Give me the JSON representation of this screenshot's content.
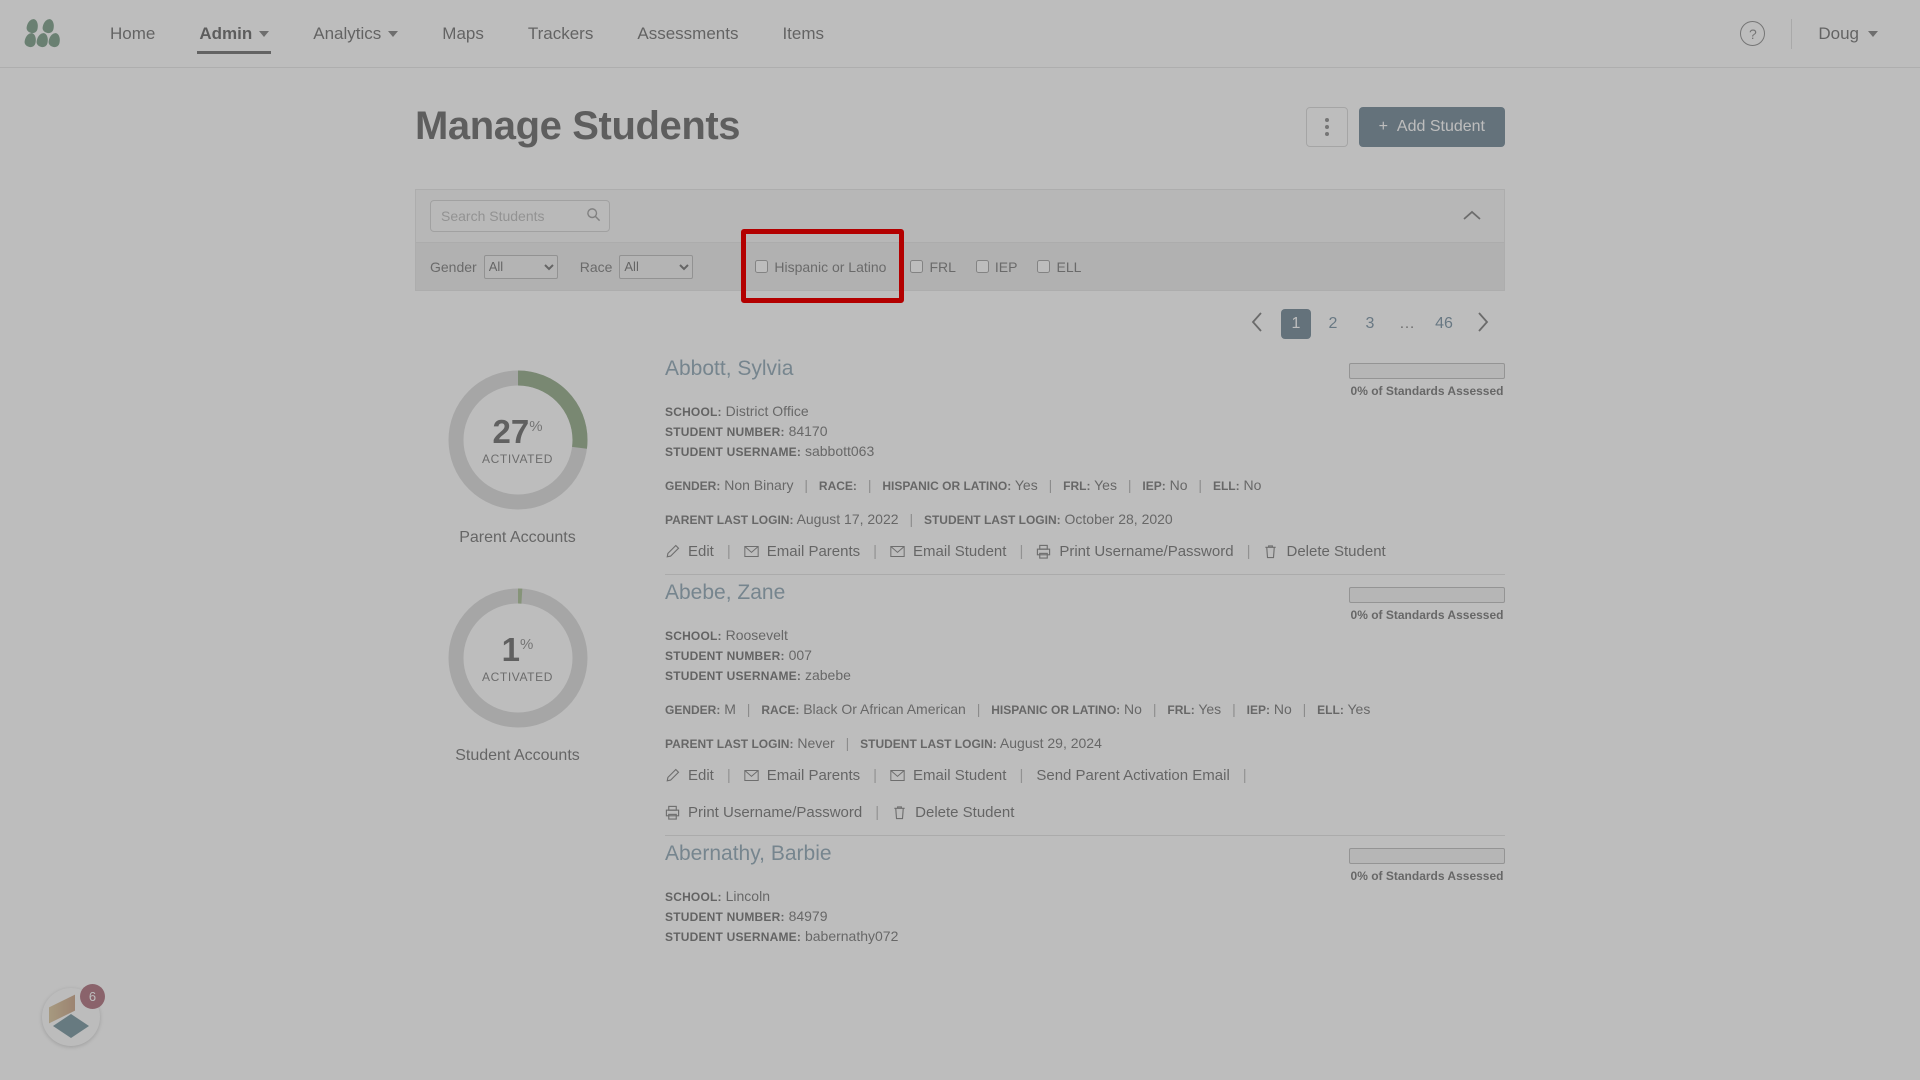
{
  "nav": {
    "logo_name": "masterybook-logo",
    "items": [
      {
        "label": "Home",
        "has_caret": false,
        "active": false
      },
      {
        "label": "Admin",
        "has_caret": true,
        "active": true
      },
      {
        "label": "Analytics",
        "has_caret": true,
        "active": false
      },
      {
        "label": "Maps",
        "has_caret": false,
        "active": false
      },
      {
        "label": "Trackers",
        "has_caret": false,
        "active": false
      },
      {
        "label": "Assessments",
        "has_caret": false,
        "active": false
      },
      {
        "label": "Items",
        "has_caret": false,
        "active": false
      }
    ],
    "help_glyph": "?",
    "user": "Doug"
  },
  "header": {
    "title": "Manage Students",
    "add_student_label": "Add Student",
    "add_student_plus": "+",
    "more_options_label": "More options"
  },
  "filters": {
    "search_placeholder": "Search Students",
    "search_value": "",
    "collapse_glyph": "⌃",
    "gender_label": "Gender",
    "gender_value": "All",
    "gender_options": [
      "All"
    ],
    "race_label": "Race",
    "race_value": "All",
    "race_options": [
      "All"
    ],
    "checkboxes": [
      {
        "label": "Hispanic or Latino",
        "checked": false,
        "highlighted": true
      },
      {
        "label": "FRL",
        "checked": false,
        "highlighted": false
      },
      {
        "label": "IEP",
        "checked": false,
        "highlighted": false
      },
      {
        "label": "ELL",
        "checked": false,
        "highlighted": false
      }
    ]
  },
  "pagination": {
    "prev_glyph": "‹",
    "next_glyph": "›",
    "pages": [
      "1",
      "2",
      "3",
      "…",
      "46"
    ],
    "active": "1"
  },
  "donuts": [
    {
      "value": "27",
      "unit": "%",
      "sub": "ACTIVATED",
      "caption": "Parent Accounts",
      "percent": 27,
      "color": "#4a8b2c"
    },
    {
      "value": "1",
      "unit": "%",
      "sub": "ACTIVATED",
      "caption": "Student Accounts",
      "percent": 1,
      "color": "#6aa832"
    }
  ],
  "labels": {
    "school": "SCHOOL:",
    "student_number": "STUDENT NUMBER:",
    "student_username": "STUDENT USERNAME:",
    "gender": "GENDER:",
    "race": "RACE:",
    "hispanic": "HISPANIC OR LATINO:",
    "frl": "FRL:",
    "iep": "IEP:",
    "ell": "ELL:",
    "parent_last_login": "PARENT LAST LOGIN:",
    "student_last_login": "STUDENT LAST LOGIN:",
    "standards_assessed": "0% of Standards Assessed"
  },
  "students": [
    {
      "name": "Abbott, Sylvia",
      "school": "District Office",
      "student_number": "84170",
      "student_username": "sabbott063",
      "gender": "Non Binary",
      "race": "",
      "hispanic": "Yes",
      "frl": "Yes",
      "iep": "No",
      "ell": "No",
      "parent_last_login": "August 17, 2022",
      "student_last_login": "October 28, 2020",
      "standards": "0% of Standards Assessed",
      "progress_percent": 0,
      "actions": [
        "Edit",
        "Email Parents",
        "Email Student",
        "Print Username/Password",
        "Delete Student"
      ]
    },
    {
      "name": "Abebe, Zane",
      "school": "Roosevelt",
      "student_number": "007",
      "student_username": "zabebe",
      "gender": "M",
      "race": "Black Or African American",
      "hispanic": "No",
      "frl": "Yes",
      "iep": "No",
      "ell": "Yes",
      "parent_last_login": "Never",
      "student_last_login": "August 29, 2024",
      "standards": "0% of Standards Assessed",
      "progress_percent": 0,
      "actions": [
        "Edit",
        "Email Parents",
        "Email Student",
        "Send Parent Activation Email",
        "Print Username/Password",
        "Delete Student"
      ]
    },
    {
      "name": "Abernathy, Barbie",
      "school": "Lincoln",
      "student_number": "84979",
      "student_username": "babernathy072",
      "gender": "",
      "race": "",
      "hispanic": "",
      "frl": "",
      "iep": "",
      "ell": "",
      "parent_last_login": "",
      "student_last_login": "",
      "standards": "0% of Standards Assessed",
      "progress_percent": 0,
      "actions": []
    }
  ],
  "widget": {
    "badge_count": "6",
    "name": "help-chat-widget"
  }
}
